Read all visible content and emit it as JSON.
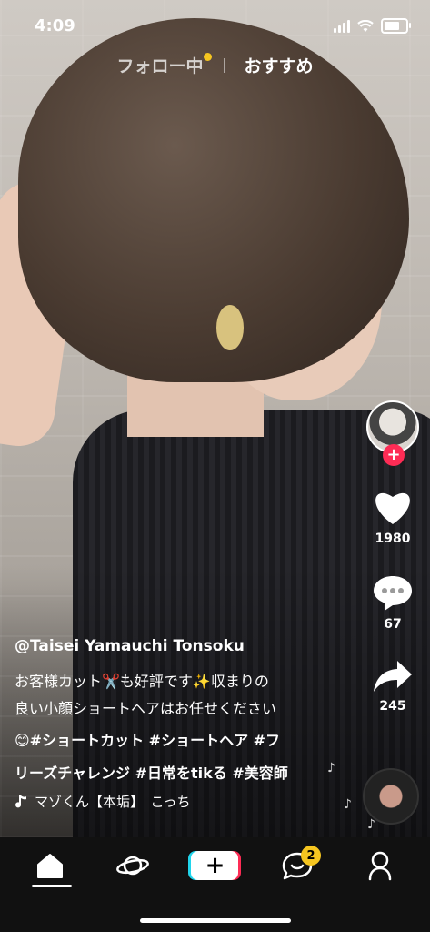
{
  "status_bar": {
    "time": "4:09",
    "battery_level": 0.9
  },
  "top_tabs": {
    "following": "フォロー中",
    "for_you": "おすすめ"
  },
  "side_rail": {
    "likes": "1980",
    "comments": "67",
    "shares": "245"
  },
  "caption": {
    "username": "@Taisei Yamauchi Tonsoku",
    "line1": "お客様カット✂️も好評です✨収まりの",
    "line2": "良い小顔ショートヘアはお任せください",
    "tags_line1": "😊#ショートカット #ショートヘア #フ",
    "tags_line2": "リーズチャレンジ #日常をtikる #美容師",
    "music": "マゾくん【本垢】　こっち"
  },
  "bottom_nav": {
    "inbox_badge": "2"
  },
  "colors": {
    "accent_red": "#fe2c55",
    "accent_cyan": "#20d5ec",
    "badge_yellow": "#f6c620"
  },
  "icons": [
    "home-icon",
    "discover-icon",
    "create-icon",
    "inbox-icon",
    "profile-icon",
    "heart-icon",
    "comment-icon",
    "share-icon",
    "music-note-icon"
  ]
}
